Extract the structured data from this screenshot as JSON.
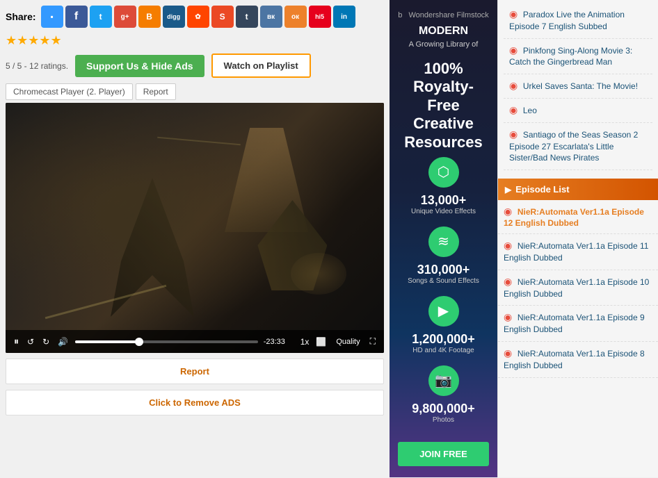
{
  "share": {
    "label": "Share:",
    "icons": [
      {
        "name": "delicious",
        "class": "delicious",
        "text": "▪"
      },
      {
        "name": "facebook",
        "class": "facebook",
        "text": "f"
      },
      {
        "name": "twitter",
        "class": "twitter",
        "text": "t"
      },
      {
        "name": "googleplus",
        "class": "gplus",
        "text": "g+"
      },
      {
        "name": "blogger",
        "class": "blogger",
        "text": "B"
      },
      {
        "name": "digg",
        "class": "digg",
        "text": "digg"
      },
      {
        "name": "reddit",
        "class": "reddit",
        "text": "r"
      },
      {
        "name": "stumbleupon",
        "class": "stumble",
        "text": "S"
      },
      {
        "name": "tumblr",
        "class": "tumblr",
        "text": "t"
      },
      {
        "name": "vk",
        "class": "vk",
        "text": "вк"
      },
      {
        "name": "ok",
        "class": "ok",
        "text": "ок"
      },
      {
        "name": "hi5",
        "class": "hi5",
        "text": "hi5"
      },
      {
        "name": "linkedin",
        "class": "linkedin",
        "text": "in"
      }
    ]
  },
  "ratings": {
    "stars": "★★★★★",
    "text": "5 / 5 - 12 ratings."
  },
  "buttons": {
    "support": "Support Us & Hide Ads",
    "playlist": "Watch on Playlist"
  },
  "player": {
    "chromecast_label": "Chromecast Player (2. Player)",
    "report_label": "Report",
    "time": "-23:33",
    "speed": "1x",
    "quality": "Quality"
  },
  "report_bar": {
    "label": "Report"
  },
  "remove_ads_bar": {
    "label": "Click to Remove ADS"
  },
  "ad": {
    "logo": "Wondershare Filmstock",
    "brand": "MODERN",
    "tagline": "A Growing Library of",
    "big_text": "100%\nRoyalty-Free\nCreative Resources",
    "features": [
      {
        "icon": "⬡",
        "stat": "13,000+",
        "label": "Unique Video Effects"
      },
      {
        "icon": "≋",
        "stat": "310,000+",
        "label": "Songs & Sound Effects"
      },
      {
        "icon": "▶",
        "stat": "1,200,000+",
        "label": "HD and 4K Footage"
      },
      {
        "icon": "📷",
        "stat": "9,800,000+",
        "label": "Photos"
      }
    ],
    "join_btn": "JOIN FREE"
  },
  "right_items": [
    {
      "text": "Paradox Live the Animation Episode 7 English Subbed"
    },
    {
      "text": "Pinkfong Sing-Along Movie 3: Catch the Gingerbread Man"
    },
    {
      "text": "Urkel Saves Santa: The Movie!"
    },
    {
      "text": "Leo"
    },
    {
      "text": "Santiago of the Seas Season 2 Episode 27 Escarlata's Little Sister/Bad News Pirates"
    }
  ],
  "episode_list": {
    "header": "Episode List",
    "items": [
      {
        "text": "NieR:Automata Ver1.1a Episode 12 English Dubbed",
        "highlight": true
      },
      {
        "text": "NieR:Automata Ver1.1a Episode 11 English Dubbed"
      },
      {
        "text": "NieR:Automata Ver1.1a Episode 10 English Dubbed"
      },
      {
        "text": "NieR:Automata Ver1.1a Episode 9 English Dubbed"
      },
      {
        "text": "NieR:Automata Ver1.1a Episode 8 English Dubbed"
      }
    ]
  }
}
